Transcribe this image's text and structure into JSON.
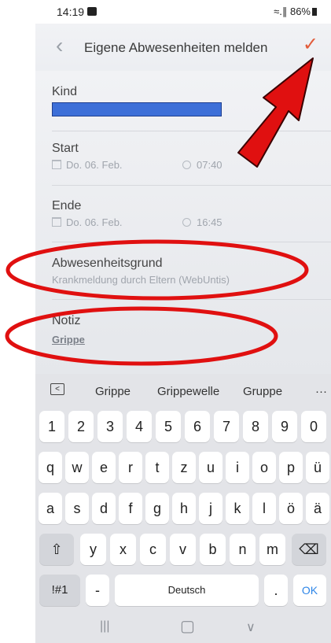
{
  "status_bar": {
    "time": "14:19",
    "signal_battery": "≈.∥ 86%"
  },
  "header": {
    "back_glyph": "‹",
    "title": "Eigene Abwesenheiten melden",
    "confirm_glyph": "✓"
  },
  "form": {
    "child": {
      "label": "Kind"
    },
    "start": {
      "label": "Start",
      "date": "Do. 06. Feb.",
      "time": "07:40"
    },
    "end": {
      "label": "Ende",
      "date": "Do. 06. Feb.",
      "time": "16:45"
    },
    "reason": {
      "label": "Abwesenheitsgrund",
      "value": "Krankmeldung durch Eltern (WebUntis)"
    },
    "note": {
      "label": "Notiz",
      "value": "Grippe"
    }
  },
  "keyboard": {
    "suggestions": [
      "Grippe",
      "Grippewelle",
      "Gruppe"
    ],
    "more_glyph": "···",
    "collapse_glyph": "<",
    "row_numbers": [
      "1",
      "2",
      "3",
      "4",
      "5",
      "6",
      "7",
      "8",
      "9",
      "0"
    ],
    "row_1": [
      "q",
      "w",
      "e",
      "r",
      "t",
      "z",
      "u",
      "i",
      "o",
      "p",
      "ü"
    ],
    "row_2": [
      "a",
      "s",
      "d",
      "f",
      "g",
      "h",
      "j",
      "k",
      "l",
      "ö",
      "ä"
    ],
    "row_3": [
      "y",
      "x",
      "c",
      "v",
      "b",
      "n",
      "m"
    ],
    "shift_glyph": "⇧",
    "backspace_glyph": "⌫",
    "symbols_label": "!#1",
    "dash_label": "-",
    "space_label": "Deutsch",
    "period_label": ".",
    "ok_label": "OK"
  },
  "nav_bar": {
    "recents_glyph": "|||",
    "home_glyph": "▢",
    "back_glyph": "∨"
  },
  "colors": {
    "accent_check": "#e25b3a",
    "annotation_red": "#e01010",
    "redaction_blue": "#3d6fd8",
    "ok_blue": "#2e86e8"
  },
  "icons": [
    "gallery-icon",
    "calendar-icon",
    "clock-icon",
    "chevron-left-icon",
    "checkmark-icon",
    "keyboard-collapse-icon",
    "shift-icon",
    "backspace-icon",
    "red-arrow-annotation",
    "red-ellipse-annotation"
  ]
}
